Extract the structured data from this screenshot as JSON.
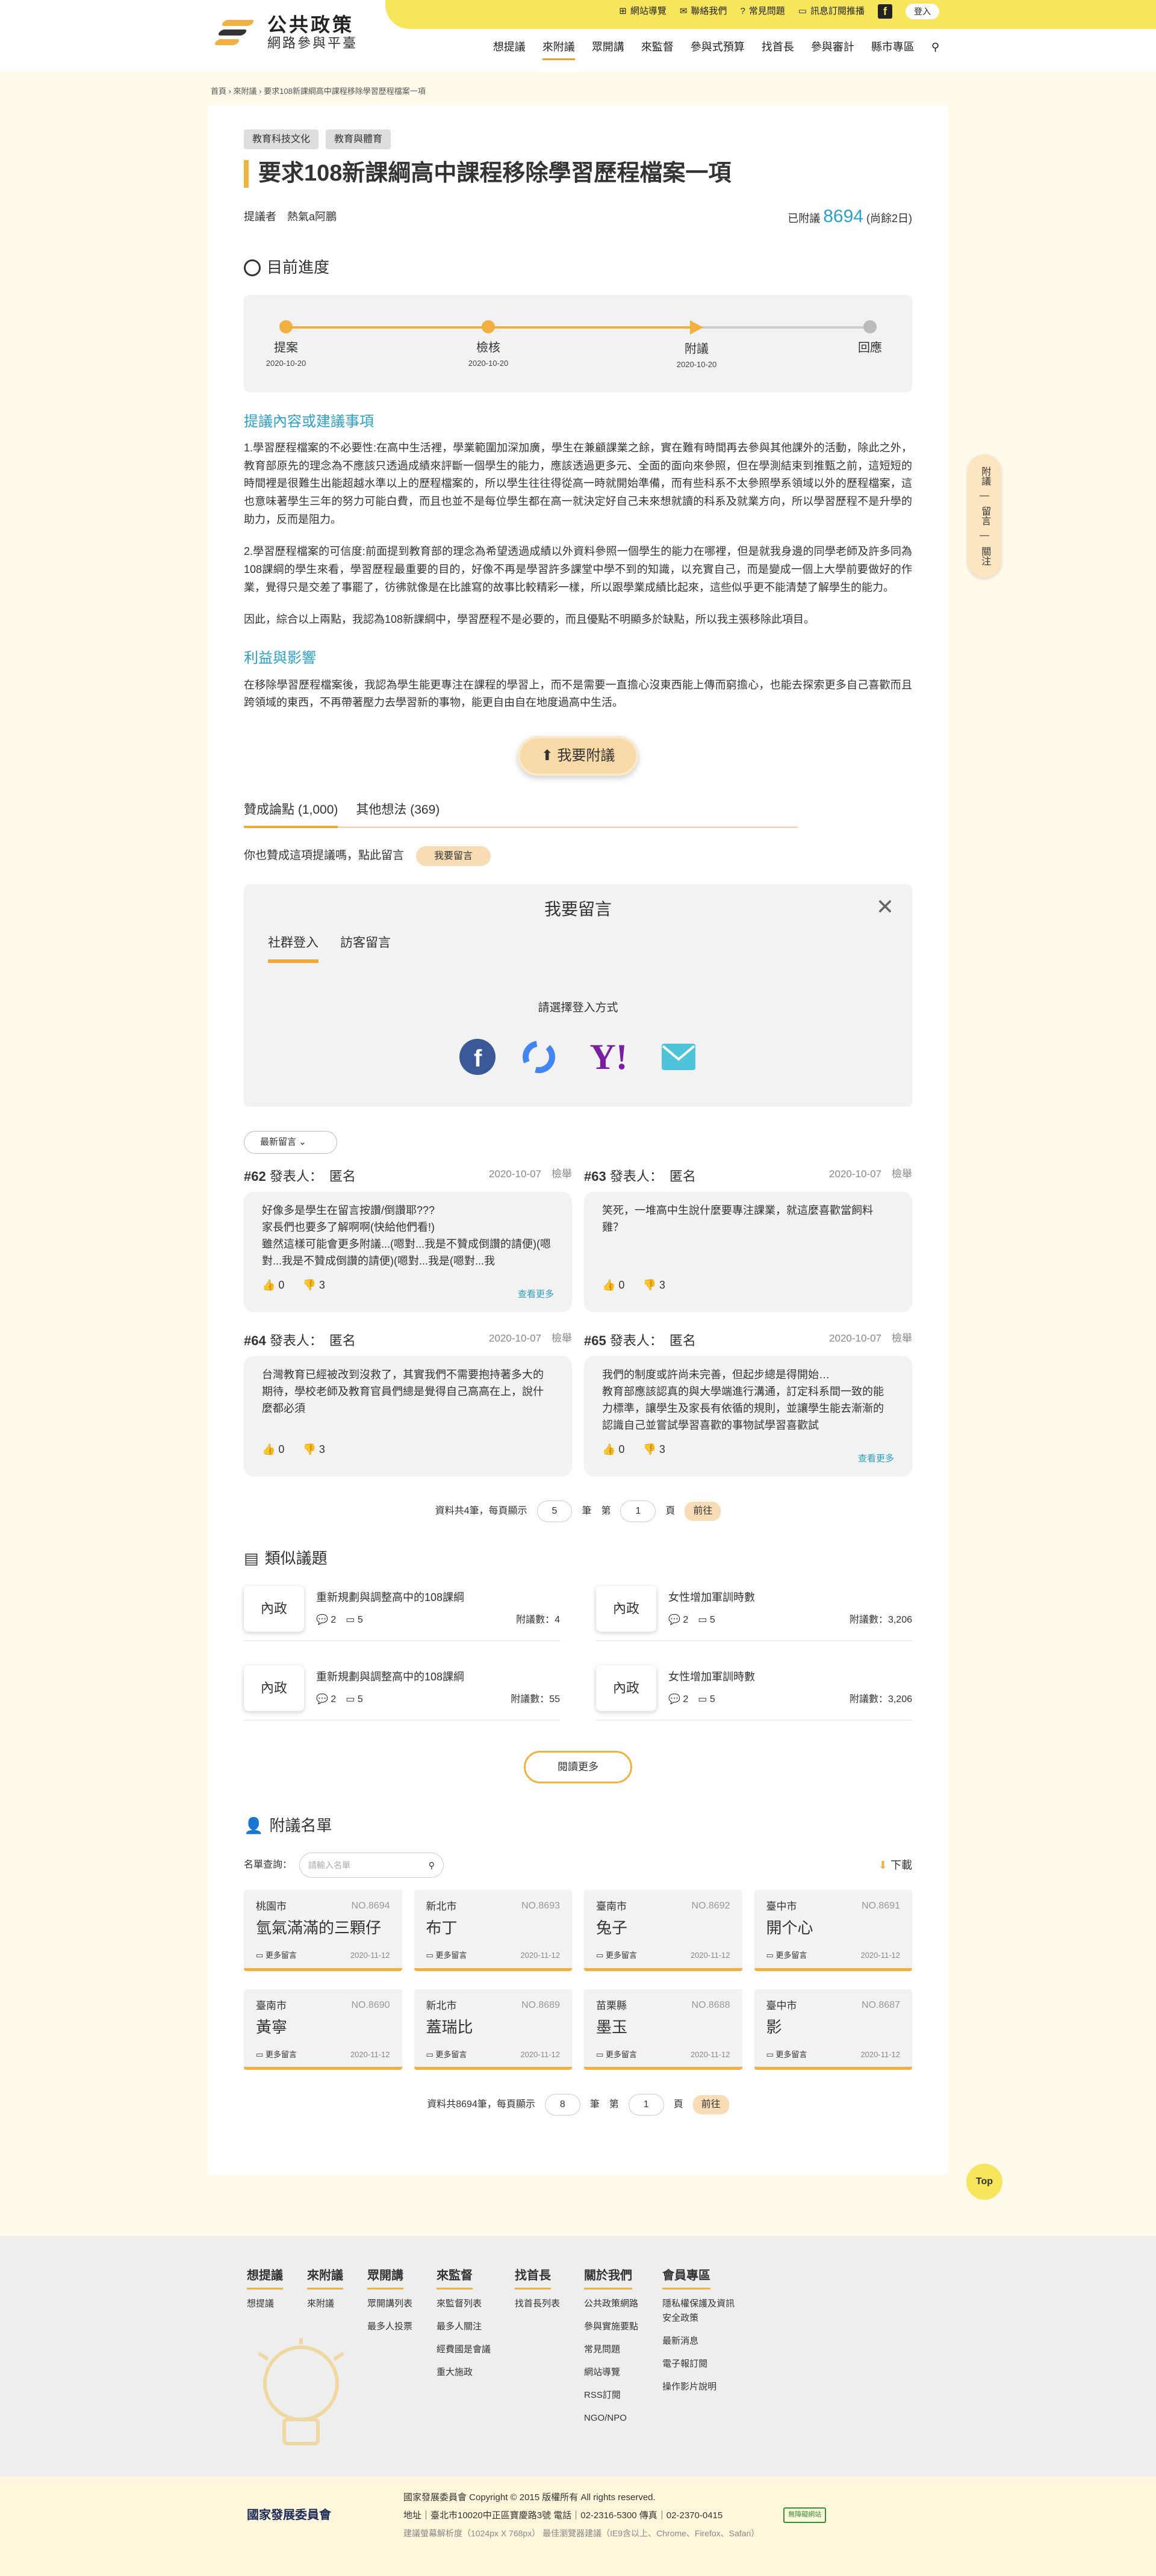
{
  "header": {
    "logo_title": "公共政策",
    "logo_subtitle": "網路參與平臺",
    "util": [
      "網站導覽",
      "聯絡我們",
      "常見問題",
      "訊息訂閱推播"
    ],
    "fb": "f",
    "login": "登入",
    "nav": [
      "想提議",
      "來附議",
      "眾開講",
      "來監督",
      "參與式預算",
      "找首長",
      "參與審計",
      "縣市專區"
    ]
  },
  "breadcrumb": "首頁 › 來附議 › 要求108新課綱高中課程移除學習歷程檔案一項",
  "tags": [
    "教育科技文化",
    "教育與體育"
  ],
  "title": "要求108新課綱高中課程移除學習歷程檔案一項",
  "proposer_label": "提議者",
  "proposer": "熱氣a阿鵬",
  "endorse_prefix": "已附議",
  "endorse_count": "8694",
  "endorse_suffix": "(尚餘2日)",
  "progress": {
    "title": "目前進度",
    "steps": [
      {
        "label": "提案",
        "date": "2020-10-20"
      },
      {
        "label": "檢核",
        "date": "2020-10-20"
      },
      {
        "label": "附議",
        "date": "2020-10-20"
      },
      {
        "label": "回應",
        "date": ""
      }
    ]
  },
  "content_title": "提議內容或建議事項",
  "p1": "1.學習歷程檔案的不必要性:在高中生活裡，學業範圍加深加廣，學生在兼顧課業之餘，實在難有時間再去參與其他課外的活動，除此之外，教育部原先的理念為不應該只透過成績來評斷一個學生的能力，應該透過更多元、全面的面向來參照，但在學測結束到推甄之前，這短短的時間裡是很難生出能超越水準以上的歷程檔案的，所以學生往往得從高一時就開始準備，而有些科系不太參照學系領域以外的歷程檔案，這也意味著學生三年的努力可能白費，而且也並不是每位學生都在高一就決定好自己未來想就讀的科系及就業方向，所以學習歷程不是升學的助力，反而是阻力。",
  "p2": "2.學習歷程檔案的可信度:前面提到教育部的理念為希望透過成績以外資料參照一個學生的能力在哪裡，但是就我身邊的同學老師及許多同為108課綱的學生來看，學習歷程最重要的目的，好像不再是學習許多課堂中學不到的知識，以充實自己，而是變成一個上大學前要做好的作業，覺得只是交差了事罷了，彷彿就像是在比誰寫的故事比較精彩一樣，所以跟學業成績比起來，這些似乎更不能清楚了解學生的能力。",
  "p3": "因此，綜合以上兩點，我認為108新課綱中，學習歷程不是必要的，而且優點不明顯多於缺點，所以我主張移除此項目。",
  "benefit_title": "利益與影響",
  "p4": "在移除學習歷程檔案後，我認為學生能更專注在課程的學習上，而不是需要一直擔心沒東西能上傳而窮擔心，也能去探索更多自己喜歡而且跨領域的東西，不再帶著壓力去學習新的事物，能更自由自在地度過高中生活。",
  "endorse_btn": "我要附議",
  "tabs": [
    {
      "label": "贊成論點",
      "count": "(1,000)"
    },
    {
      "label": "其他想法",
      "count": "(369)"
    }
  ],
  "ask": "你也贊成這項提議嗎，點此留言",
  "ask_btn": "我要留言",
  "cbox": {
    "title": "我要留言",
    "close": "✕",
    "tabs": [
      "社群登入",
      "訪客留言"
    ],
    "choose": "請選擇登入方式"
  },
  "sort": "最新留言",
  "comments": [
    {
      "no": "#62",
      "by": "發表人：",
      "name": "匿名",
      "date": "2020-10-07",
      "report": "檢舉",
      "text": "好像多是學生在留言按讚/倒讚耶???\n家長們也要多了解啊啊(快給他們看!)\n雖然這樣可能會更多附議...(嗯對...我是不贊成倒讚的請便)(嗯對...我是不贊成倒讚的請便)(嗯對...我是(嗯對...我",
      "up": "0",
      "down": "3",
      "more": "查看更多"
    },
    {
      "no": "#63",
      "by": "發表人：",
      "name": "匿名",
      "date": "2020-10-07",
      "report": "檢舉",
      "text": "笑死，一堆高中生說什麼要專注課業，就這麼喜歡當飼料雞？",
      "up": "0",
      "down": "3",
      "more": ""
    },
    {
      "no": "#64",
      "by": "發表人：",
      "name": "匿名",
      "date": "2020-10-07",
      "report": "檢舉",
      "text": "台灣教育已經被改到沒救了，其實我們不需要抱持著多大的期待，學校老師及教育官員們總是覺得自己高高在上，說什麼都必須",
      "up": "0",
      "down": "3",
      "more": ""
    },
    {
      "no": "#65",
      "by": "發表人：",
      "name": "匿名",
      "date": "2020-10-07",
      "report": "檢舉",
      "text": "我們的制度或許尚未完善，但起步總是得開始…\n教育部應該認真的與大學端進行溝通，訂定科系間一致的能力標準，讓學生及家長有依循的規則，並讓學生能去漸漸的認識自己並嘗試學習喜歡的事物試學習喜歡試",
      "up": "0",
      "down": "3",
      "more": "查看更多"
    }
  ],
  "pager1": {
    "pre": "資料共4筆，每頁顯示",
    "size": "5",
    "mid": "筆",
    "page_label": "第",
    "page": "1",
    "post": "頁",
    "go": "前往"
  },
  "similar_title": "類似議題",
  "similar": [
    {
      "cat": "內政",
      "title": "重新規劃與調整高中的108課綱",
      "a": "2",
      "b": "5",
      "cnt": "附議數：4"
    },
    {
      "cat": "內政",
      "title": "女性增加軍訓時數",
      "a": "2",
      "b": "5",
      "cnt": "附議數：3,206"
    },
    {
      "cat": "內政",
      "title": "重新規劃與調整高中的108課綱",
      "a": "2",
      "b": "5",
      "cnt": "附議數：55"
    },
    {
      "cat": "內政",
      "title": "女性增加軍訓時數",
      "a": "2",
      "b": "5",
      "cnt": "附議數：3,206"
    }
  ],
  "more_btn": "閱讀更多",
  "list_title": "附議名單",
  "search_label": "名單查詢：",
  "search_ph": "請輸入名單",
  "download": "下載",
  "signers": [
    {
      "city": "桃園市",
      "no": "NO.8694",
      "name": "氫氣滿滿的三顆仔",
      "date": "2020-11-12"
    },
    {
      "city": "新北市",
      "no": "NO.8693",
      "name": "布丁",
      "date": "2020-11-12"
    },
    {
      "city": "臺南市",
      "no": "NO.8692",
      "name": "兔子",
      "date": "2020-11-12"
    },
    {
      "city": "臺中市",
      "no": "NO.8691",
      "name": "開个心",
      "date": "2020-11-12"
    },
    {
      "city": "臺南市",
      "no": "NO.8690",
      "name": "黃寧",
      "date": "2020-11-12"
    },
    {
      "city": "新北市",
      "no": "NO.8689",
      "name": "蓋瑞比",
      "date": "2020-11-12"
    },
    {
      "city": "苗栗縣",
      "no": "NO.8688",
      "name": "墨玉",
      "date": "2020-11-12"
    },
    {
      "city": "臺中市",
      "no": "NO.8687",
      "name": "影",
      "date": "2020-11-12"
    }
  ],
  "signer_more": "更多留言",
  "pager2": {
    "pre": "資料共8694筆，每頁顯示",
    "size": "8",
    "mid": "筆",
    "page_label": "第",
    "page": "1",
    "post": "頁",
    "go": "前往"
  },
  "side": [
    "附議",
    "留言",
    "關注"
  ],
  "top": "Top",
  "footer": [
    {
      "h": "想提議",
      "items": [
        "想提議"
      ]
    },
    {
      "h": "來附議",
      "items": [
        "來附議"
      ]
    },
    {
      "h": "眾開講",
      "items": [
        "眾開講列表",
        "最多人投票"
      ]
    },
    {
      "h": "來監督",
      "items": [
        "來監督列表",
        "最多人關注",
        "經費國是會議",
        "重大施政"
      ]
    },
    {
      "h": "找首長",
      "items": [
        "找首長列表"
      ]
    },
    {
      "h": "關於我們",
      "items": [
        "公共政策網路",
        "參與實施要點",
        "常見問題",
        "網站導覽",
        "RSS訂閱",
        "NGO/NPO"
      ]
    },
    {
      "h": "會員專區",
      "items": [
        "隱私權保護及資訊安全政策",
        "最新消息",
        "電子報訂閱",
        "操作影片說明"
      ]
    }
  ],
  "copy": {
    "org": "國家發展委員會",
    "line1": "國家發展委員會 Copyright © 2015 版權所有 All rights reserved.",
    "line2": "地址｜臺北市10020中正區寶慶路3號 電話｜02-2316-5300 傳真｜02-2370-0415",
    "line3": "建議螢幕解析度（1024px X 768px） 最佳瀏覽器建議（IE9含以上、Chrome、Firefox、Safari）",
    "badge": "無障礙網站"
  },
  "colors": {
    "accent": "#f3b042",
    "brand_yellow": "#f7e55c",
    "link": "#2e9fc7"
  }
}
